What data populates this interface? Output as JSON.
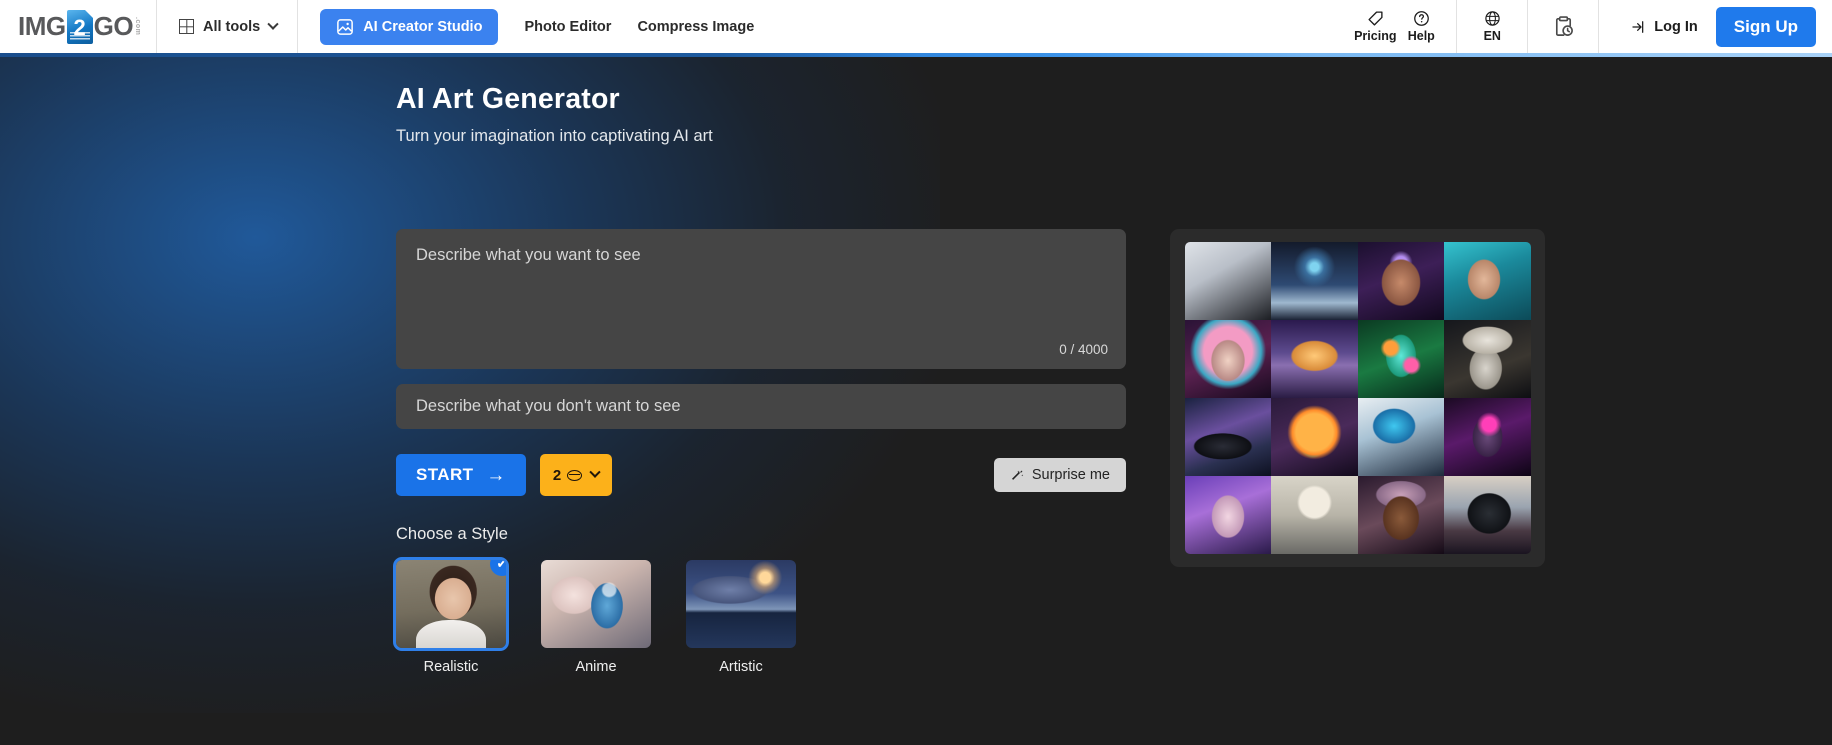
{
  "header": {
    "logo": {
      "part1": "IMG",
      "num": "2",
      "part2": "GO",
      "suffix": ".com"
    },
    "all_tools": "All tools",
    "nav": [
      {
        "label": "AI Creator Studio",
        "icon": "ai-image-icon",
        "active": true
      },
      {
        "label": "Photo Editor",
        "active": false
      },
      {
        "label": "Compress Image",
        "active": false
      }
    ],
    "right": {
      "pricing": "Pricing",
      "help": "Help",
      "language": "EN",
      "history_icon": "clipboard-clock-icon",
      "login": "Log In",
      "signup": "Sign Up"
    }
  },
  "page": {
    "title": "AI Art Generator",
    "subtitle": "Turn your imagination into captivating AI art"
  },
  "form": {
    "prompt_placeholder": "Describe what you want to see",
    "prompt_value": "",
    "char_count": "0 / 4000",
    "negative_placeholder": "Describe what you don't want to see",
    "negative_value": "",
    "start_label": "START",
    "start_arrow": "→",
    "credits_value": "2",
    "surprise_label": "Surprise me",
    "surprise_icon": "magic-wand-icon"
  },
  "styles": {
    "heading": "Choose a Style",
    "items": [
      {
        "label": "Realistic",
        "selected": true,
        "art": "art-realistic"
      },
      {
        "label": "Anime",
        "selected": false,
        "art": "art-anime"
      },
      {
        "label": "Artistic",
        "selected": false,
        "art": "art-artistic"
      }
    ],
    "check_glyph": "✔"
  },
  "gallery": {
    "cells": [
      "linear-gradient(150deg,#dfe3e8 0%,#b9bfc8 38%,#1b1d22 100%)",
      "radial-gradient(circle at 50% 32%,#7fd3f0 0 6%,#3a6f9e 14%,rgba(0,0,0,0) 30%),linear-gradient(180deg,#131a2b 0%,#2e4a73 55%,#9fb8cf 78%,#1a2335 100%)",
      "radial-gradient(ellipse 30px 36px at 50% 52%,#c68a6a 0%,#8b5742 62%,rgba(0,0,0,0) 66%),radial-gradient(circle at 50% 26%,#b58ef0 0 8%,rgba(0,0,0,0) 16%),linear-gradient(160deg,#1b0f2e 0%,#3d1f57 45%,#11081d 100%)",
      "radial-gradient(ellipse 26px 32px at 46% 48%,#e2b79a 0%,#b9876a 60%,rgba(0,0,0,0) 64%),linear-gradient(160deg,#35c3cf 0%,#1b8a9c 40%,#0c4a58 100%)",
      "radial-gradient(ellipse 26px 32px at 50% 52%,#f0d2c4 0%,#b98a86 62%,rgba(0,0,0,0) 66%),radial-gradient(circle at 50% 40%,#f39bc4 0 38%,#3aa8c4 52%,rgba(0,0,0,0) 60%),linear-gradient(160deg,#2a1336 0%,#5b2150 50%,#160a1e 100%)",
      "radial-gradient(ellipse 40px 26px at 50% 46%,#ffc978 0%,#d98c3a 55%,rgba(0,0,0,0) 60%),linear-gradient(180deg,#2b1a4e 0%,#5d4b8e 42%,#8a6fb0 58%,#2a1c44 100%)",
      "radial-gradient(circle at 38% 36%,#ff9e3a 0 9%,rgba(0,0,0,0) 14%),radial-gradient(circle at 62% 58%,#ff5fa8 0 9%,rgba(0,0,0,0) 14%),radial-gradient(ellipse 24px 34px at 50% 46%,#5fe8d8 0%,#1d9b7c 60%,rgba(0,0,0,0) 64%),linear-gradient(160deg,#0b3a22 0%,#1a7a42 50%,#06281a 100%)",
      "radial-gradient(ellipse 40px 22px at 50% 26%,#e8e4dc 0%,#b8b2a6 60%,rgba(0,0,0,0) 64%),radial-gradient(ellipse 26px 34px at 48% 62%,#d8d4cc 0%,#9b968c 60%,rgba(0,0,0,0) 64%),linear-gradient(160deg,#15171c 0%,#3a3630 60%,#0d0e12 100%)",
      "radial-gradient(ellipse 40px 18px at 44% 62%,#2a2c36 0%,#0e0f14 70%,rgba(0,0,0,0) 74%),linear-gradient(160deg,#1a2240 0%,#6a4f9e 40%,#2a3050 70%,#0d1020 100%)",
      "radial-gradient(circle at 50% 44%,#ffb347 0 30%,#ff8c2a 36%,rgba(0,0,0,0) 44%),radial-gradient(ellipse 24px 32px at 48% 50%,#2e8fa0 0%,#14576a 62%,rgba(0,0,0,0) 66%),linear-gradient(160deg,#2a1a3a 0%,#4a2a5a 50%,#120a1c 100%)",
      "radial-gradient(ellipse 34px 28px at 42% 36%,#3fc8f0 0%,#1a6fa8 60%,rgba(0,0,0,0) 64%),linear-gradient(160deg,#e8eef2 0%,#a8c2d4 40%,#1e2a3c 100%)",
      "radial-gradient(circle at 52% 34%,#ff3fb8 0 10%,rgba(0,0,0,0) 18%),radial-gradient(ellipse 24px 32px at 50% 50%,#6a4a7a 0%,#3a2448 60%,rgba(0,0,0,0) 64%),linear-gradient(160deg,#1a0a22 0%,#5a1a6a 45%,#0d0414 100%)",
      "radial-gradient(ellipse 26px 34px at 50% 52%,#f2d6e2 0%,#c49ab8 60%,rgba(0,0,0,0) 64%),linear-gradient(160deg,#6a3fb8 0%,#a86fd8 40%,#2a1a4a 100%)",
      "radial-gradient(circle at 50% 34%,#f2ece0 0 22%,rgba(0,0,0,0) 26%),linear-gradient(180deg,#d8d4c8 0%,#b8b4a8 50%,#6a6a66 100%)",
      "radial-gradient(ellipse 28px 34px at 50% 54%,#8a5a3a 0%,#5a3420 62%,rgba(0,0,0,0) 66%),radial-gradient(ellipse 40px 22px at 50% 24%,#c8a0b8 0%,#8a6a88 60%,rgba(0,0,0,0) 64%),linear-gradient(160deg,#2a1a2e 0%,#6a4a5a 50%,#140a16 100%)",
      "radial-gradient(ellipse 30px 28px at 52% 48%,#2a2e34 0%,#101216 70%,rgba(0,0,0,0) 74%),linear-gradient(180deg,#d8cfc4 0%,#9aa4b0 40%,#4a3a44 70%,#1a1420 100%)"
    ]
  }
}
